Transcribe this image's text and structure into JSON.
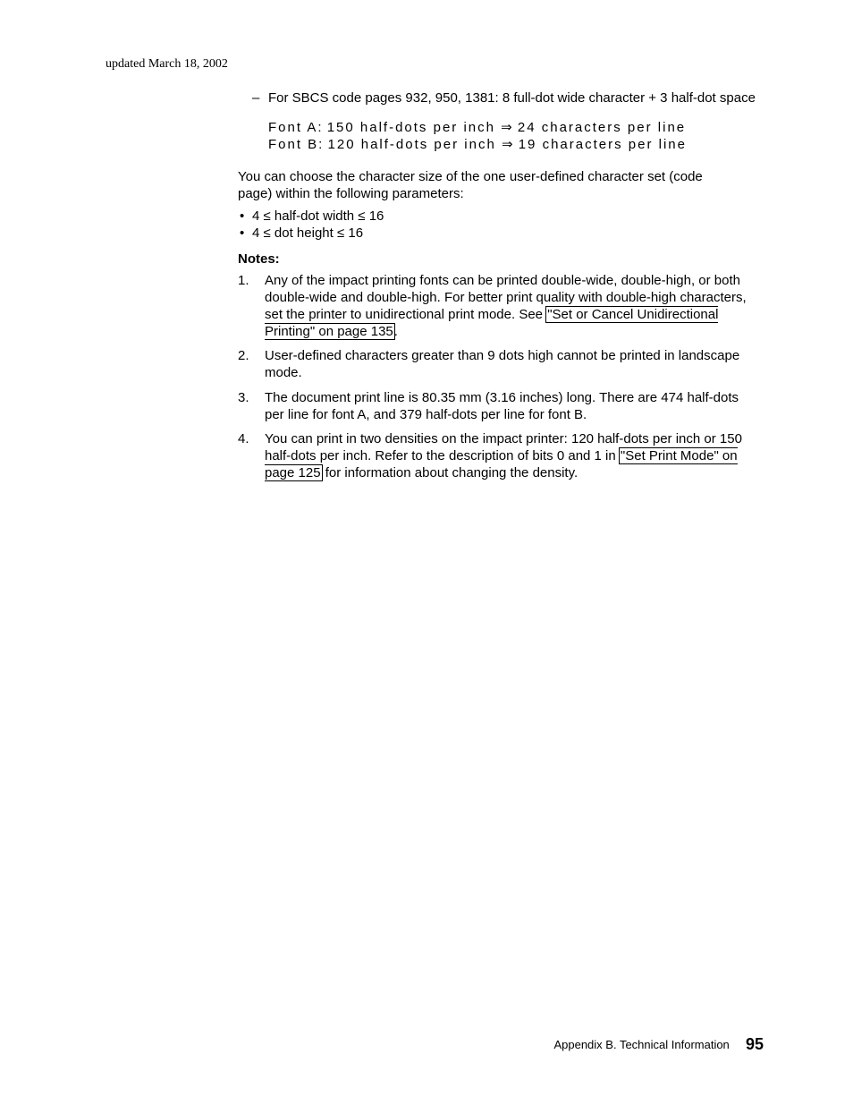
{
  "meta": {
    "header_date": "updated March 18, 2002"
  },
  "dash_item": "For SBCS code pages 932, 950, 1381: 8 full-dot wide character + 3 half-dot space",
  "fontA": {
    "label": "Font A:",
    "dpi": "150 half-dots per inch",
    "cpl": "24 characters per line"
  },
  "fontB": {
    "label": "Font B:",
    "dpi": "120 half-dots per inch",
    "cpl": "19 characters per line"
  },
  "para1_line1": "You can choose the character size of the one user-defined character set (code",
  "para1_line2": "page) within the following parameters:",
  "bullets": {
    "b1": "4 ≤ half-dot width ≤ 16",
    "b2": "4 ≤ dot height ≤ 16"
  },
  "notes_heading": "Notes:",
  "note1": {
    "pre": "Any of the impact printing fonts can be printed double-wide, double-high, or both double-wide and double-high. For better print quality with double-high characters, set the printer to unidirectional print mode. See ",
    "link": "\"Set or Cancel Unidirectional Printing\" on page 135",
    "post": "."
  },
  "note2": "User-defined characters greater than 9 dots high cannot be printed in landscape mode.",
  "note3": "The document print line is 80.35 mm (3.16 inches) long. There are 474 half-dots per line for font A, and 379 half-dots per line for font B.",
  "note4": {
    "pre": "You can print in two densities on the impact printer: 120 half-dots per inch or 150 half-dots per inch. Refer to the description of bits 0 and 1 in ",
    "link": "\"Set Print Mode\" on page 125",
    "post": " for information about changing the density."
  },
  "footer": {
    "appendix": "Appendix B. Technical Information",
    "page_number": "95"
  }
}
